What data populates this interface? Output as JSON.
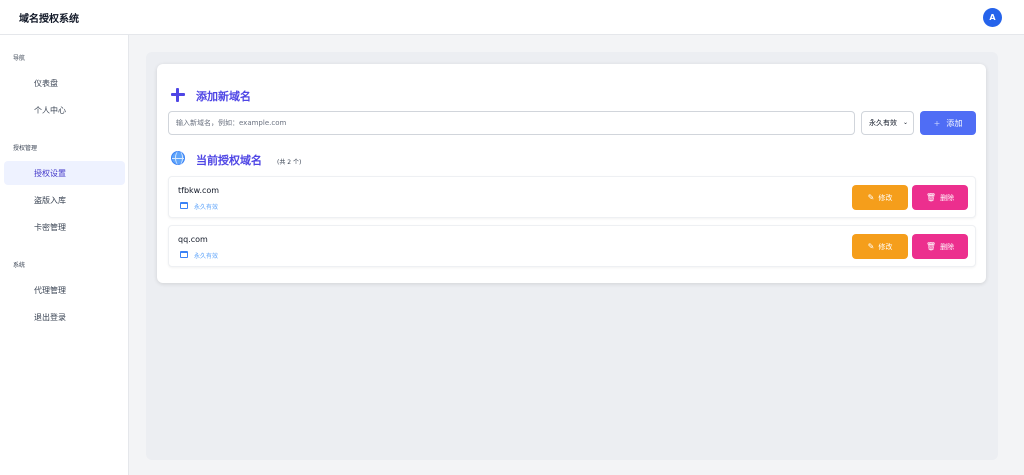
{
  "app": {
    "title": "域名授权系统",
    "avatar_initial": "A"
  },
  "sidebar": {
    "sections": [
      {
        "title": "导航",
        "items": [
          {
            "label": "仪表盘"
          },
          {
            "label": "个人中心"
          }
        ]
      },
      {
        "title": "授权管理",
        "items": [
          {
            "label": "授权设置",
            "active": true
          },
          {
            "label": "盗版入库"
          },
          {
            "label": "卡密管理"
          }
        ]
      },
      {
        "title": "系统",
        "items": [
          {
            "label": "代理管理"
          },
          {
            "label": "退出登录"
          }
        ]
      }
    ]
  },
  "add_domain": {
    "title": "添加新域名",
    "input_placeholder": "输入新域名，例如：example.com",
    "input_value": "",
    "duration_selected": "永久有效",
    "add_button_label": "添加"
  },
  "current_domains": {
    "title": "当前授权域名",
    "count_note": "(共 2 个)",
    "items": [
      {
        "domain": "tfbkw.com",
        "validity": "永久有效",
        "edit_label": "修改",
        "delete_label": "删除"
      },
      {
        "domain": "qq.com",
        "validity": "永久有效",
        "edit_label": "修改",
        "delete_label": "删除"
      }
    ]
  },
  "colors": {
    "accent": "#4f46e5",
    "avatar": "#2563eb",
    "edit_button": "#f59e1b",
    "delete_button": "#ec2f8e",
    "add_button": "#4f6df5"
  },
  "icons": {
    "add_section": "plus-icon",
    "domains_section": "globe-icon",
    "validity": "calendar-icon",
    "edit": "pencil-icon",
    "delete": "trash-icon"
  }
}
